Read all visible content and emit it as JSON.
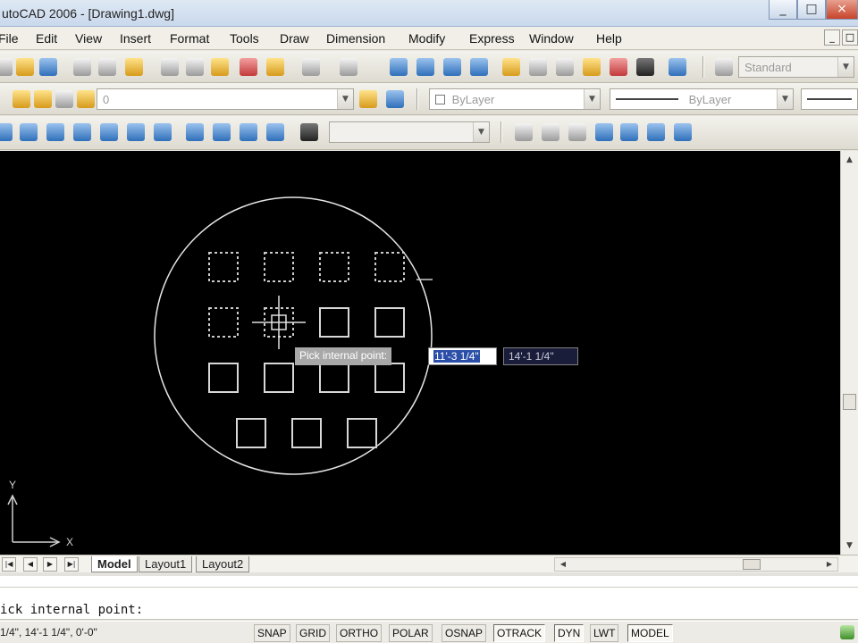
{
  "window": {
    "title": "utoCAD 2006 - [Drawing1.dwg]",
    "controls": [
      "_",
      "□",
      "×"
    ]
  },
  "menu": {
    "items": [
      "File",
      "Edit",
      "View",
      "Insert",
      "Format",
      "Tools",
      "Draw",
      "Dimension",
      "Modify",
      "Express",
      "Window",
      "Help"
    ],
    "mdi_controls": [
      "_",
      "□"
    ]
  },
  "toolbars": {
    "text_style": "Standard",
    "layer": "0",
    "color": "ByLayer",
    "linetype": "ByLayer"
  },
  "drawing": {
    "prompt_tooltip": "Pick internal point:",
    "dyn_input_x": "11'-3 1/4\"",
    "dyn_input_y": "14'-1 1/4\"",
    "ucs_x": "X",
    "ucs_y": "Y",
    "colors": {
      "background": "#000000",
      "geometry": "#e6e6e6",
      "selected": "#cccccc"
    }
  },
  "layout_tabs": {
    "tabs": [
      "Model",
      "Layout1",
      "Layout2"
    ],
    "active": "Model"
  },
  "command_line": {
    "prompt": "ick internal point:"
  },
  "status_bar": {
    "coords": "1/4\", 14'-1 1/4\", 0'-0\"",
    "toggles": [
      {
        "label": "SNAP",
        "on": false
      },
      {
        "label": "GRID",
        "on": false
      },
      {
        "label": "ORTHO",
        "on": false
      },
      {
        "label": "POLAR",
        "on": false
      },
      {
        "label": "OSNAP",
        "on": false
      },
      {
        "label": "OTRACK",
        "on": true
      },
      {
        "label": "DYN",
        "on": true
      },
      {
        "label": "LWT",
        "on": false
      },
      {
        "label": "MODEL",
        "on": true
      }
    ]
  }
}
